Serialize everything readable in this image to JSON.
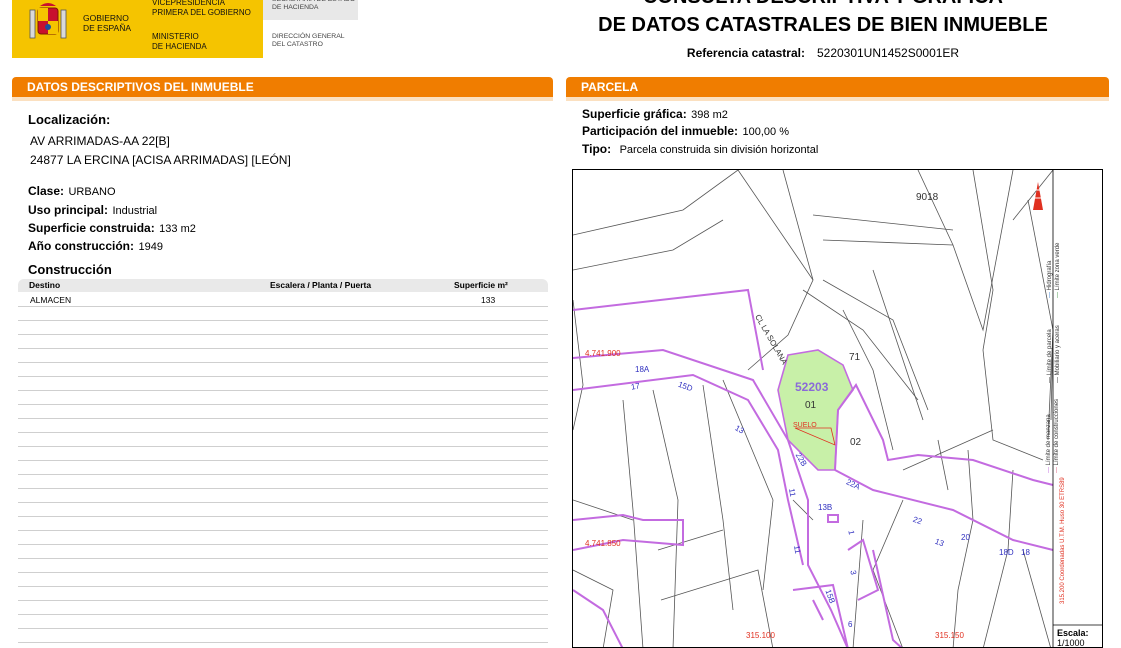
{
  "header": {
    "gobierno": "GOBIERNO\nDE ESPAÑA",
    "vicepresidencia": "VICEPRESIDENCIA\nPRIMERA DEL GOBIERNO",
    "ministerio": "MINISTERIO\nDE HACIENDA",
    "secretaria": "SECRETARÍA DE ESTADO\nDE HACIENDA",
    "direccion": "DIRECCIÓN GENERAL\nDEL CATASTRO",
    "title_line1": "CONSULTA DESCRIPTIVA Y GRÁFICA",
    "title_line2": "DE DATOS CATASTRALES DE BIEN INMUEBLE",
    "ref_label": "Referencia catastral:",
    "ref_value": "5220301UN1452S0001ER"
  },
  "datos": {
    "section_title_a": "DATOS DESCRIPTIVOS DEL ",
    "section_title_b": "INMUEBLE",
    "localizacion_label": "Localización:",
    "localizacion_line1": "AV ARRIMADAS-AA 22[B]",
    "localizacion_line2": "24877 LA ERCINA [ACISA ARRIMADAS] [LEÓN]",
    "clase_label": "Clase:",
    "clase_value": "URBANO",
    "uso_label": "Uso principal:",
    "uso_value": "Industrial",
    "superficie_label": "Superficie construida:",
    "superficie_value": "133 m2",
    "anio_label": "Año construcción:",
    "anio_value": "1949",
    "construccion_title": "Construcción",
    "table_headers": [
      "Destino",
      "Escalera / Planta / Puerta",
      "Superficie m²"
    ],
    "table_rows": [
      {
        "destino": "ALMACEN",
        "escalera": "",
        "superficie": "133"
      }
    ]
  },
  "parcela": {
    "section_title": "PARCELA",
    "superficie_label": "Superficie gráfica:",
    "superficie_value": "398 m2",
    "participacion_label": "Participación del inmueble:",
    "participacion_value": "100,00 %",
    "tipo_label": "Tipo:",
    "tipo_value": "Parcela construida sin división horizontal"
  },
  "map": {
    "labels": {
      "n9018": "9018",
      "n71": "71",
      "n52203": "52203",
      "n01": "01",
      "suelo": "SUELO",
      "n02": "02",
      "n18a": "18A",
      "n17": "17",
      "n15d": "15D",
      "n13": "13",
      "n22b": "22B",
      "n22a": "22A",
      "n13b": "13B",
      "n11": "11",
      "n22": "22",
      "n20": "20",
      "n18d": "18D",
      "n18": "18",
      "n1": "1",
      "n3": "3",
      "n15b": "15B",
      "n6": "6",
      "n13c": "13",
      "street": "CL LA SOLANA",
      "coord_y1": "4.741.900",
      "coord_y2": "4.741.850",
      "coord_x1": "315.100",
      "coord_x2": "315.150"
    },
    "legend": {
      "hidrografia": "Hidrografía",
      "limite_zona_verde": "Límite zona verde",
      "limite_parcela": "Límite de parcela",
      "mobiliario": "Mobiliario y aceras",
      "limite_manzana": "Límite de manzana",
      "limite_construcciones": "Límite de construcciones",
      "coordenadas": "Coordenadas U.T.M. Huso 30 ETRS89",
      "coord_value": "315.200"
    },
    "scale_label": "Escala:",
    "scale_value": "1/1000",
    "colors": {
      "manzana": "#c36be0",
      "parcela_fill": "#c8f0a8",
      "coord_red": "#e03020",
      "label_blue": "#3030c0"
    }
  }
}
